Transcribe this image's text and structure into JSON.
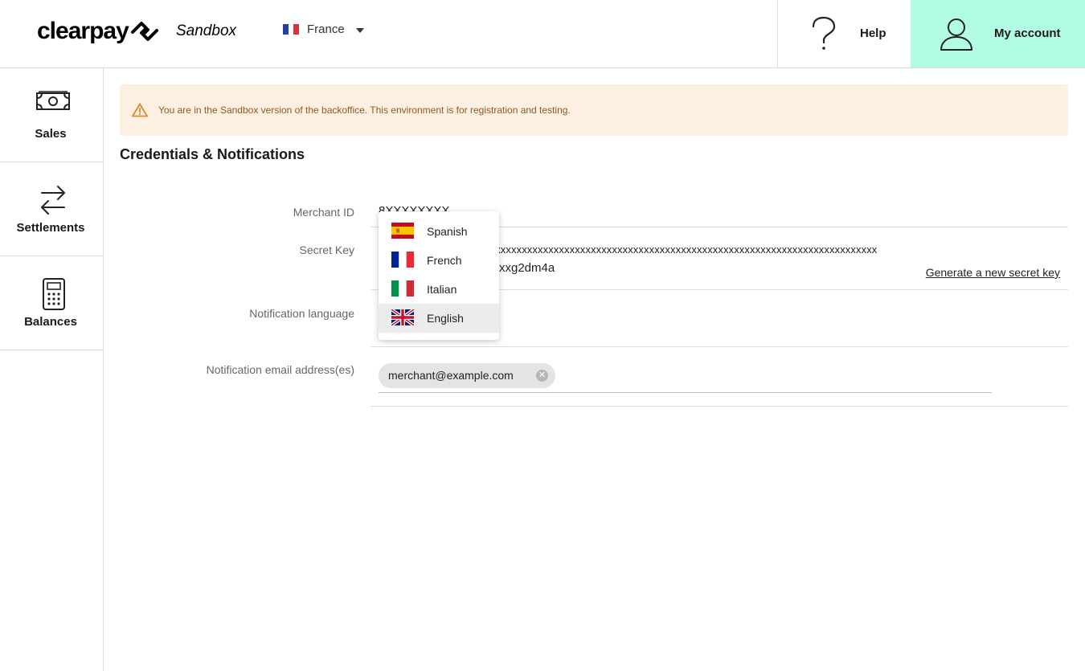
{
  "header": {
    "logo_text": "clearpay",
    "sandbox_label": "Sandbox",
    "country": "France",
    "help_label": "Help",
    "account_label": "My account",
    "accent_color": "#b2fce4"
  },
  "sidebar": {
    "items": [
      {
        "label": "Sales",
        "icon": "cash-icon"
      },
      {
        "label": "Settlements",
        "icon": "transfer-arrows-icon"
      },
      {
        "label": "Balances",
        "icon": "calculator-icon"
      }
    ]
  },
  "banner": {
    "text": "You are in the Sandbox version of the backoffice. This environment is for registration and testing.",
    "icon": "warning-icon",
    "background_color": "#fdf0e2"
  },
  "page": {
    "title": "Credentials & Notifications"
  },
  "fields": {
    "merchant_id_label": "Merchant ID",
    "merchant_id_value": "8XXXXXXXX",
    "secret_key_label": "Secret Key",
    "secret_key_line1": "xxxxxxxxxxxxxxxxxxxxxxxxxxxxxxxxxxxxxxxxxxxxxxxxxxxxxxxxxxxxxxxxxxxxxxxxxxxxxxxxxxxxxxxxxxxxxx",
    "secret_key_line2": "xxg2dm4a",
    "generate_link": "Generate a new secret key",
    "notification_language_label": "Notification language",
    "notification_email_label": "Notification email address(es)",
    "email_chip": "merchant@example.com"
  },
  "language_dropdown": {
    "options": [
      {
        "label": "Spanish",
        "icon": "spain-flag-icon"
      },
      {
        "label": "French",
        "icon": "france-flag-icon"
      },
      {
        "label": "Italian",
        "icon": "italy-flag-icon"
      },
      {
        "label": "English",
        "icon": "uk-flag-icon",
        "selected": true
      }
    ]
  }
}
